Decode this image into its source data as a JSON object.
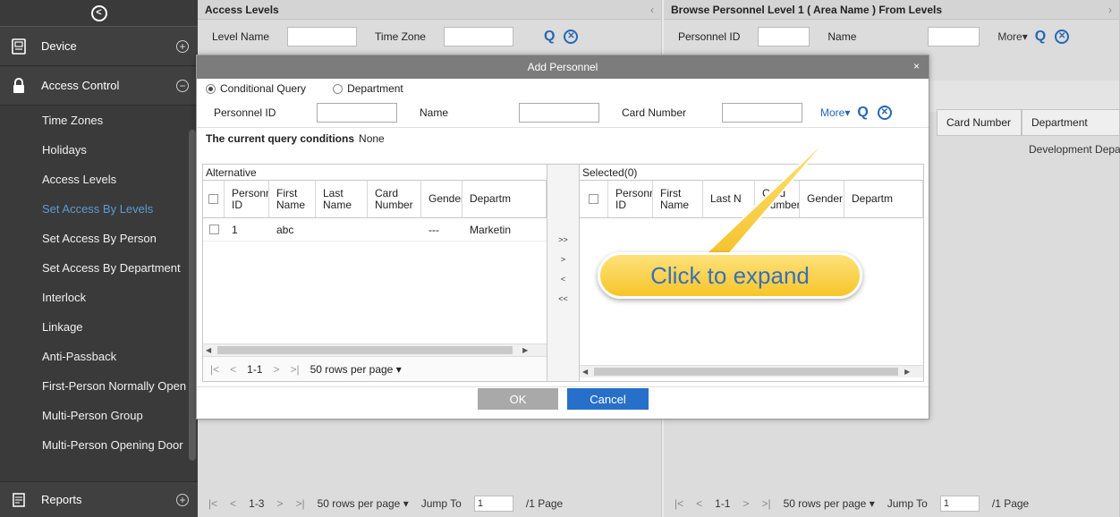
{
  "sidebar": {
    "sections": [
      {
        "label": "Device",
        "icon": "device-icon",
        "toggle": "+"
      },
      {
        "label": "Access Control",
        "icon": "lock-icon",
        "toggle": "−"
      }
    ],
    "items": [
      {
        "label": "Time Zones"
      },
      {
        "label": "Holidays"
      },
      {
        "label": "Access Levels"
      },
      {
        "label": "Set Access By Levels",
        "active": true
      },
      {
        "label": "Set Access By Person"
      },
      {
        "label": "Set Access By Department"
      },
      {
        "label": "Interlock"
      },
      {
        "label": "Linkage"
      },
      {
        "label": "Anti-Passback"
      },
      {
        "label": "First-Person Normally Open"
      },
      {
        "label": "Multi-Person Group"
      },
      {
        "label": "Multi-Person Opening Door"
      }
    ],
    "bottom_section": {
      "label": "Reports",
      "toggle": "+"
    }
  },
  "access_levels_panel": {
    "title": "Access Levels",
    "filters": [
      "Level Name",
      "Time Zone"
    ],
    "pager": {
      "first": "|<",
      "prev": "<",
      "range": "1-3",
      "next": ">",
      "last": ">|",
      "rows": "50 rows per page",
      "jump_label": "Jump To",
      "page_input": "1",
      "page_total": "/1 Page"
    }
  },
  "browse_panel": {
    "title": "Browse Personnel Level 1 ( Area Name ) From Levels",
    "filters": [
      "Personnel ID",
      "Name"
    ],
    "more": "More",
    "columns": [
      "Card Number",
      "Department"
    ],
    "cell_department": "Development Depart",
    "pager": {
      "first": "|<",
      "prev": "<",
      "range": "1-1",
      "next": ">",
      "last": ">|",
      "rows": "50 rows per page",
      "jump_label": "Jump To",
      "page_input": "1",
      "page_total": "/1 Page"
    }
  },
  "modal": {
    "title": "Add Personnel",
    "close": "×",
    "radio_conditional": "Conditional Query",
    "radio_department": "Department",
    "query_labels": {
      "personnel_id": "Personnel ID",
      "name": "Name",
      "card_number": "Card Number"
    },
    "more": "More",
    "conditions_label": "The current query conditions",
    "conditions_value": "None",
    "alternative_caption": "Alternative",
    "selected_caption": "Selected(0)",
    "columns": [
      "Personnel ID",
      "First Name",
      "Last Name",
      "Card Number",
      "Gender",
      "Department"
    ],
    "selected_columns": [
      "Personnel ID",
      "First Name",
      "Last N",
      "Card Number",
      "Gender",
      "Departm"
    ],
    "alternative_header_department": "Departm",
    "rows": [
      {
        "id": "1",
        "first": "abc",
        "last": "",
        "card": "",
        "gender": "---",
        "department": "Marketing"
      }
    ],
    "move_buttons": [
      ">>",
      ">",
      "<",
      "<<"
    ],
    "pager": {
      "first": "|<",
      "prev": "<",
      "range": "1-1",
      "next": ">",
      "last": ">|",
      "rows": "50 rows per page"
    },
    "ok": "OK",
    "cancel": "Cancel"
  },
  "callout": {
    "text": "Click to expand"
  }
}
